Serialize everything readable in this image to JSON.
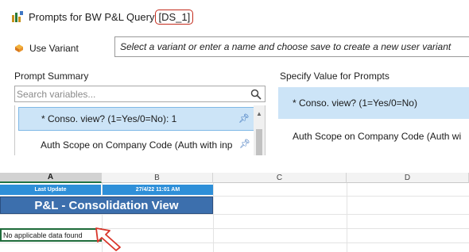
{
  "dialog": {
    "title_prefix": "Prompts for BW P&L Query",
    "title_highlight": "[DS_1]",
    "variant_label": "Use Variant",
    "variant_placeholder": "Select a variant or enter a name and choose save to create a new user variant",
    "prompt_summary_label": "Prompt Summary",
    "search_placeholder": "Search variables...",
    "prompts": [
      {
        "label": "* Conso. view? (1=Yes/0=No): 1",
        "selected": true
      },
      {
        "label": "Auth Scope on Company Code (Auth with inp",
        "selected": false
      }
    ],
    "specify_value_label": "Specify Value for Prompts",
    "value_items": [
      {
        "label": "* Conso. view? (1=Yes/0=No)",
        "selected": true
      },
      {
        "label": "Auth Scope on Company Code (Auth wi",
        "selected": false
      }
    ]
  },
  "sheet": {
    "columns": [
      "A",
      "B",
      "C",
      "D"
    ],
    "last_update_label": "Last Update",
    "last_update_value": "27/4/22 11:01 AM",
    "report_title": "P&L - Consolidation View",
    "message": "No applicable data found"
  },
  "colors": {
    "highlight_border": "#c42b1c",
    "selection_blue": "#cce4f7",
    "cell_blue": "#2e8fd8",
    "title_band": "#3c6fad",
    "excel_green": "#217346"
  }
}
